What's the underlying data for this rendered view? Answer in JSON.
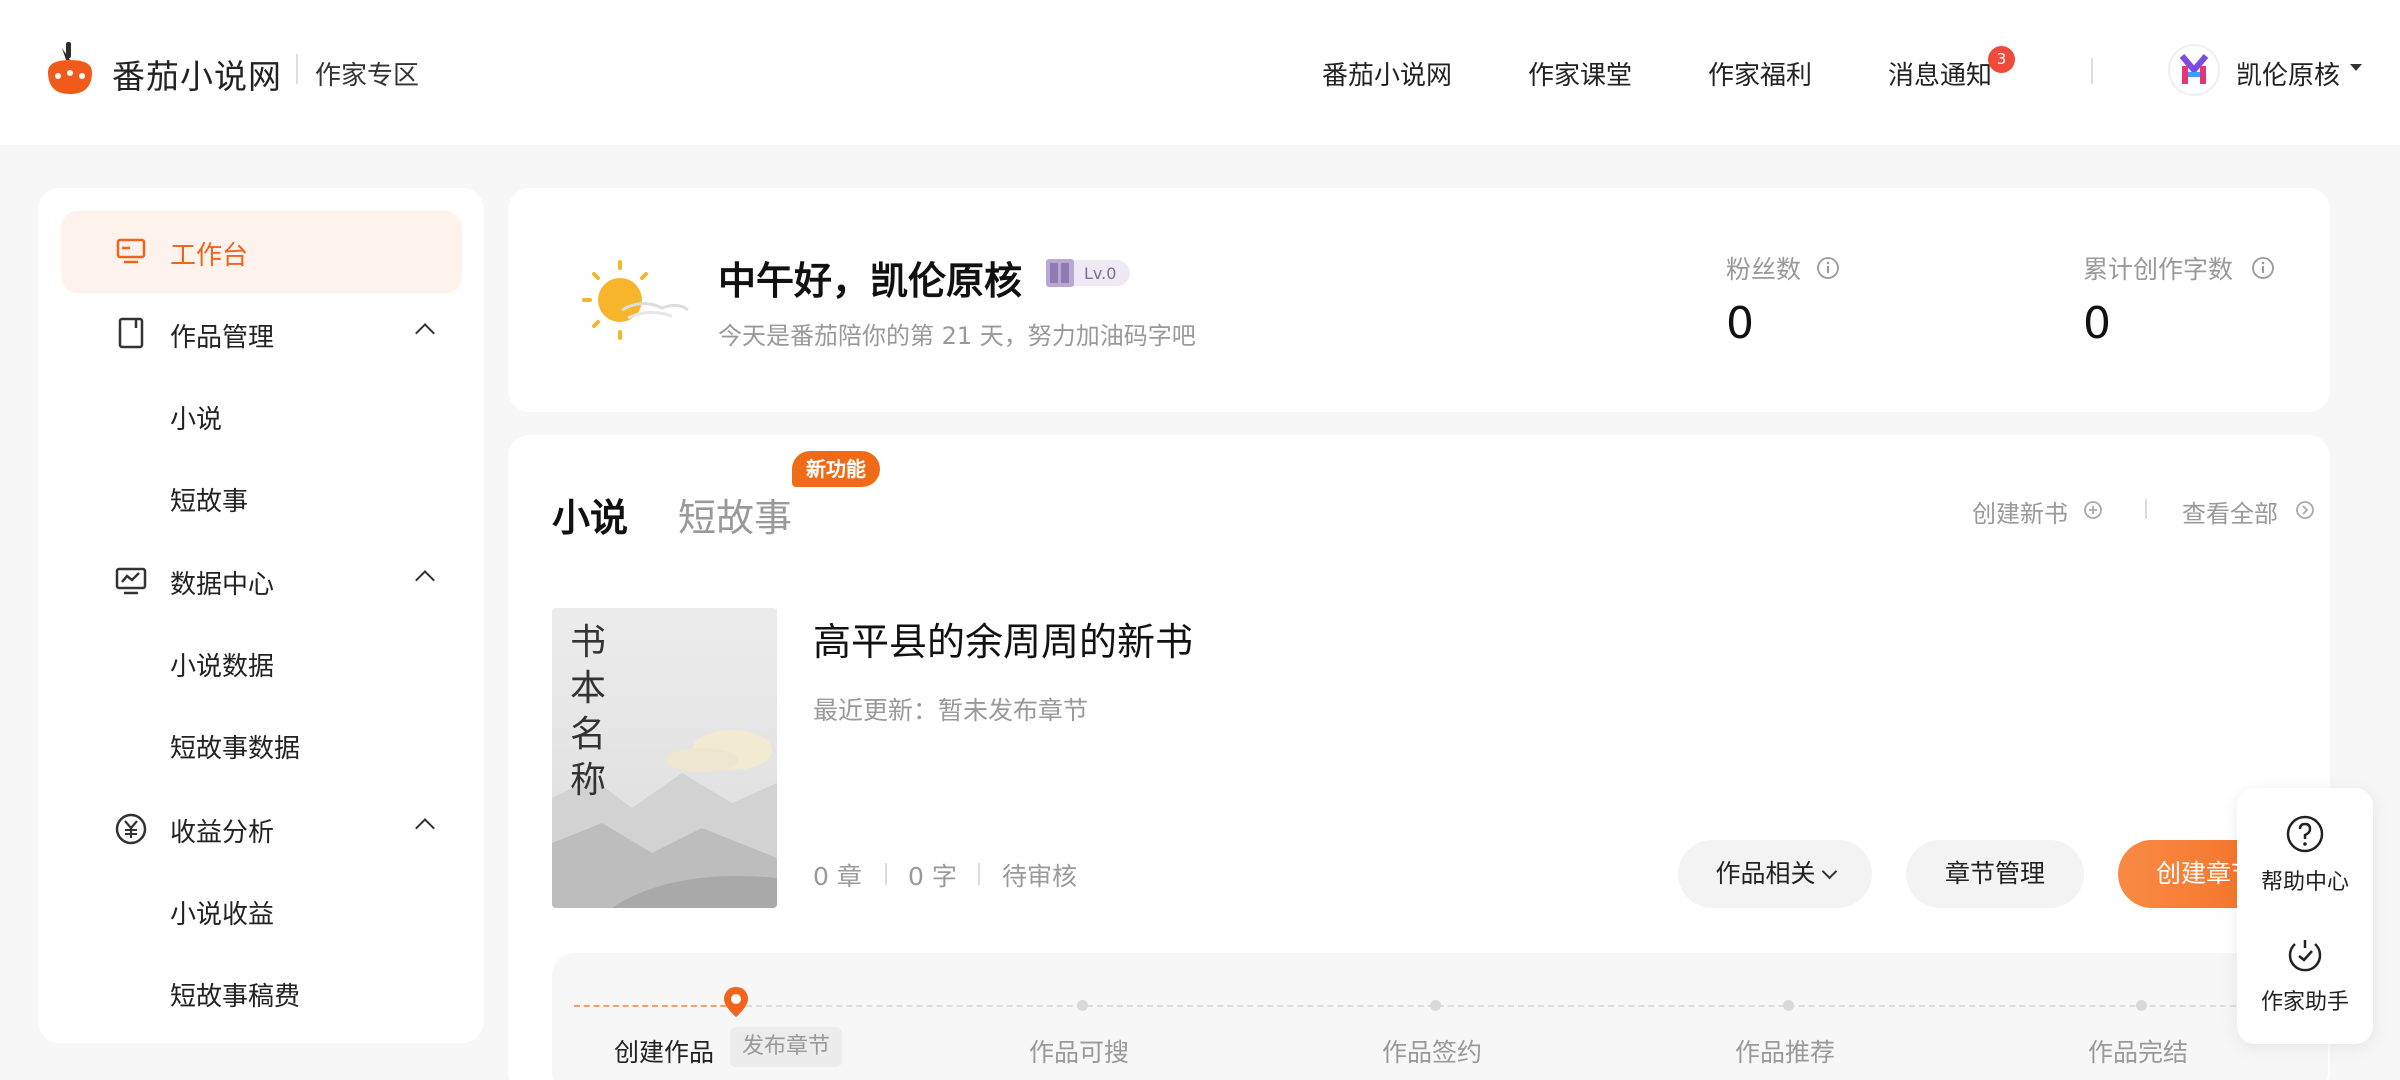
{
  "header": {
    "brand": "番茄小说网",
    "brand_sub": "作家专区",
    "nav": [
      "番茄小说网",
      "作家课堂",
      "作家福利",
      "消息通知"
    ],
    "notif_count": "3",
    "username": "凯伦原核"
  },
  "sidebar": {
    "workbench": "工作台",
    "works_manage": "作品管理",
    "novel": "小说",
    "short_story": "短故事",
    "data_center": "数据中心",
    "novel_data": "小说数据",
    "short_story_data": "短故事数据",
    "revenue": "收益分析",
    "novel_revenue": "小说收益",
    "short_story_fee": "短故事稿费"
  },
  "greeting": {
    "title": "中午好，凯伦原核",
    "level": "Lv.0",
    "subtitle": "今天是番茄陪你的第 21 天，努力加油码字吧",
    "fans_label": "粉丝数",
    "fans_value": "0",
    "words_label": "累计创作字数",
    "words_value": "0"
  },
  "works": {
    "tab_novel": "小说",
    "tab_short": "短故事",
    "new_badge": "新功能",
    "create_book": "创建新书",
    "view_all": "查看全部",
    "cover_text": "书本名称",
    "book_title": "高平县的余周周的新书",
    "last_update": "最近更新：暂未发布章节",
    "chapters": "0 章",
    "words": "0 字",
    "status": "待审核",
    "btn_related": "作品相关",
    "btn_chapter_manage": "章节管理",
    "btn_create_chapter": "创建章节"
  },
  "steps": {
    "items": [
      "创建作品",
      "作品可搜",
      "作品签约",
      "作品推荐",
      "作品完结"
    ],
    "current_tag": "发布章节"
  },
  "float": {
    "help": "帮助中心",
    "assistant": "作家助手"
  },
  "colors": {
    "accent": "#f0641e",
    "badge_red": "#f04a3a",
    "page_bg": "#f7f7f7"
  }
}
